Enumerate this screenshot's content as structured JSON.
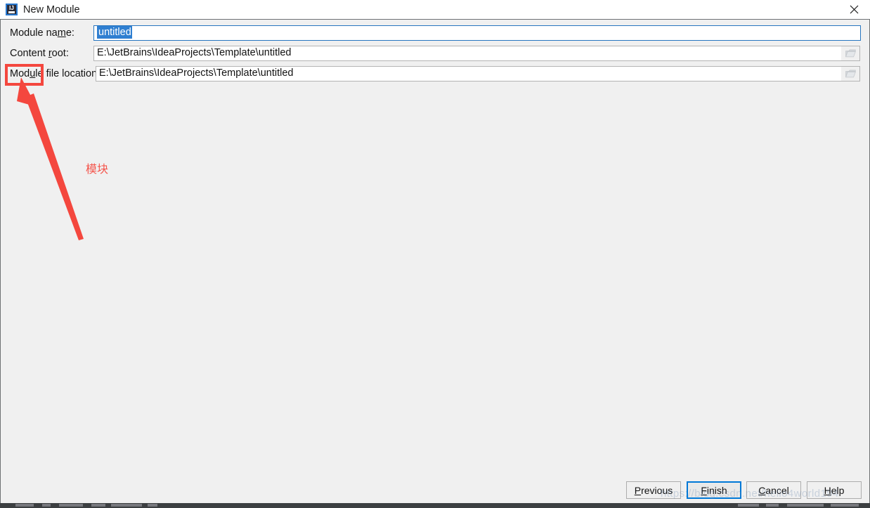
{
  "window": {
    "title": "New Module",
    "icon": "intellij-idea-icon",
    "icon_letters": "IJ",
    "close_icon": "close-icon"
  },
  "form": {
    "rows": [
      {
        "label_pre": "Module na",
        "label_mnemonic": "m",
        "label_post": "e:",
        "value": "untitled",
        "selected": true,
        "focused": true,
        "has_browse": false
      },
      {
        "label_pre": "Content ",
        "label_mnemonic": "r",
        "label_post": "oot:",
        "value": "E:\\JetBrains\\IdeaProjects\\Template\\untitled",
        "selected": false,
        "focused": false,
        "has_browse": true,
        "browse_icon": "folder-icon"
      },
      {
        "label_pre": "Mod",
        "label_mnemonic": "u",
        "label_post": "le file location:",
        "value": "E:\\JetBrains\\IdeaProjects\\Template\\untitled",
        "selected": false,
        "focused": false,
        "has_browse": true,
        "browse_icon": "folder-icon"
      }
    ]
  },
  "annotation": {
    "text": "模块",
    "color": "#f4473e",
    "box_target": "Module",
    "arrow": "arrow-pointing-to-module-label"
  },
  "footer": {
    "buttons": [
      {
        "label": "Previous",
        "mnemonic_index": 0,
        "default": false
      },
      {
        "label": "Finish",
        "mnemonic_index": 0,
        "default": true
      },
      {
        "label": "Cancel",
        "mnemonic_index": 0,
        "default": false
      },
      {
        "label": "Help",
        "mnemonic_index": 0,
        "default": false
      }
    ]
  },
  "watermark": {
    "text": "https://blog.csdn.net/hello4world194"
  },
  "colors": {
    "dialog_background": "#f0f0f0",
    "titlebar_background": "#ffffff",
    "field_background": "#ffffff",
    "field_border": "#b4b4b4",
    "focus_border": "#2675bf",
    "selection_blue": "#2f7fd1",
    "annotation_red": "#f4473e",
    "default_button_border": "#0078d7",
    "taskbar": "#3c3f41"
  }
}
